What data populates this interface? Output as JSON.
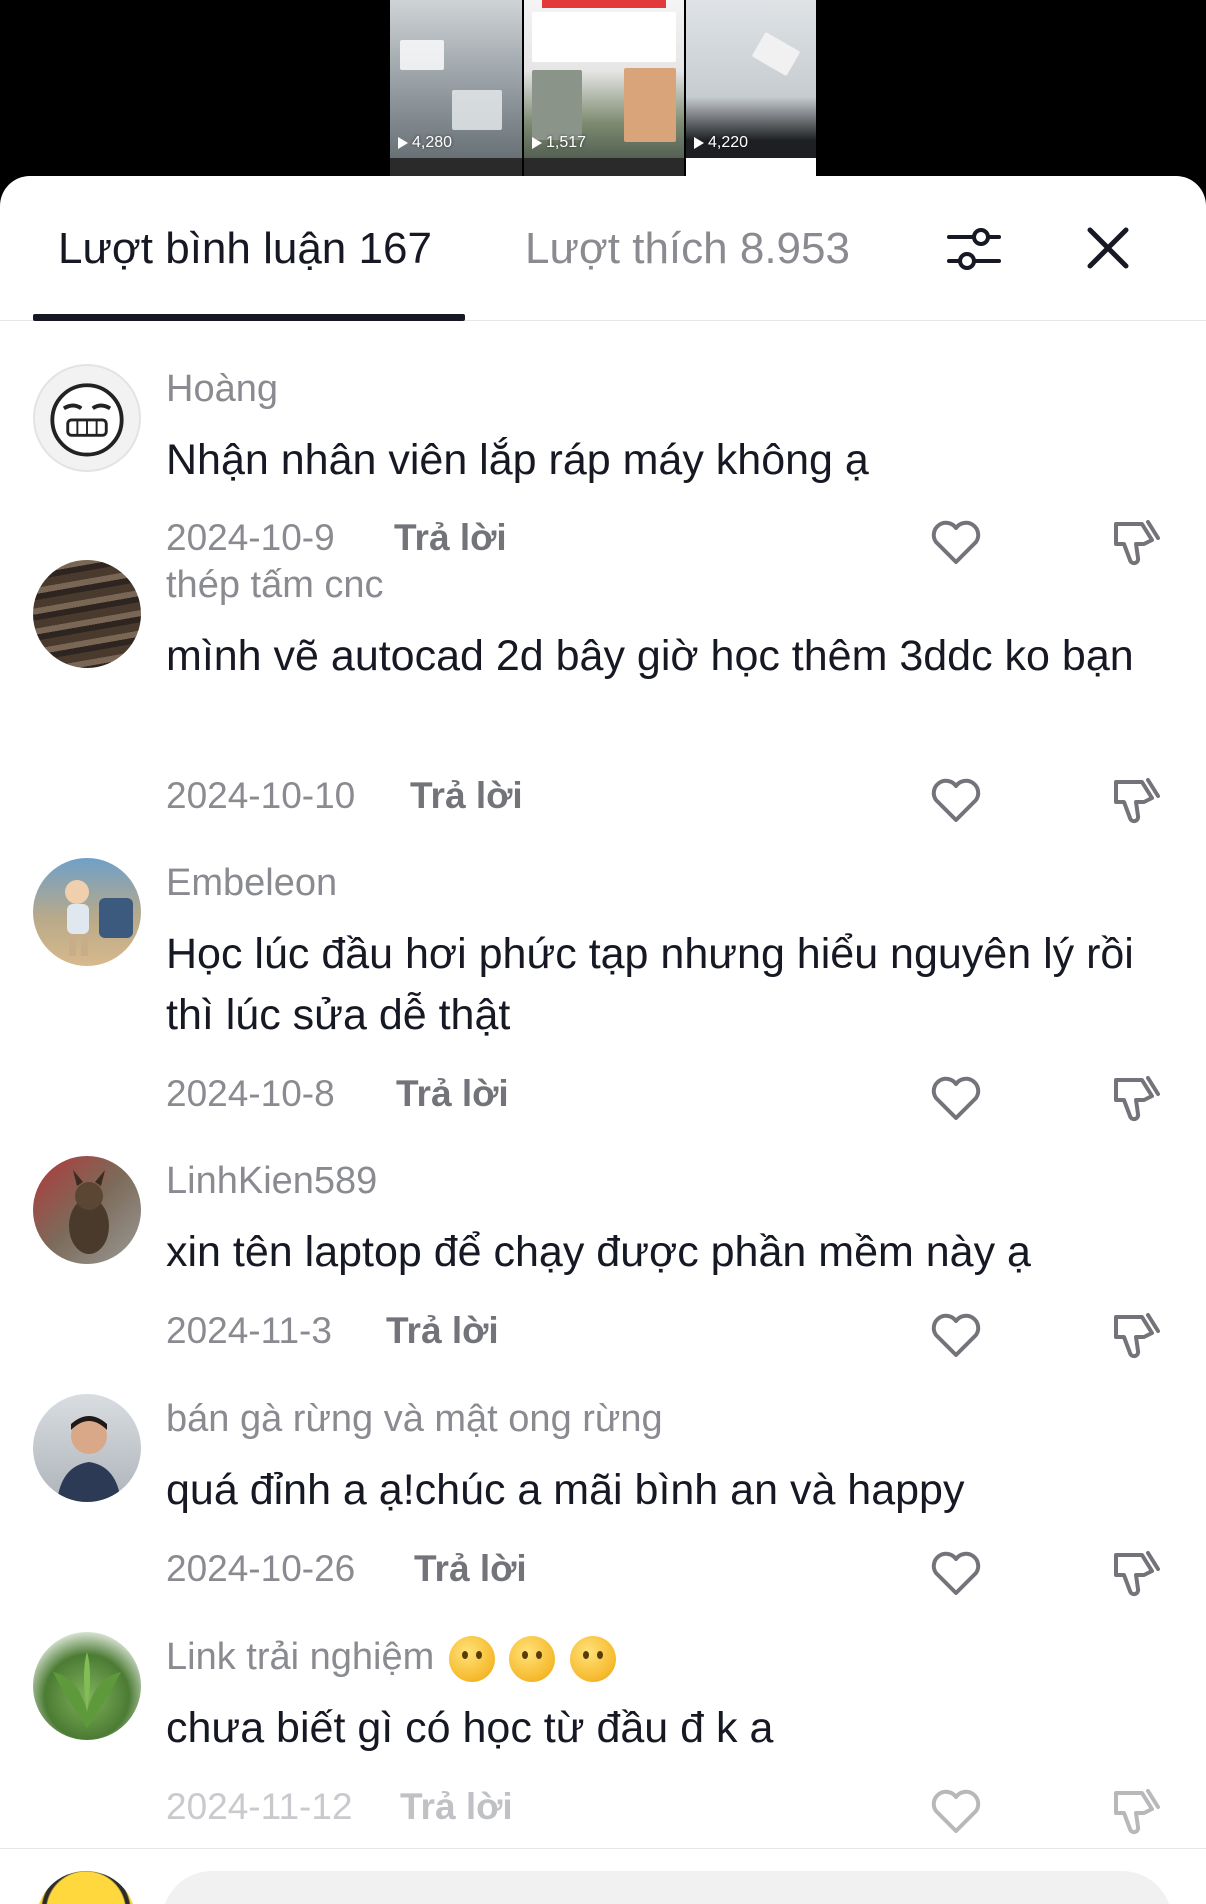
{
  "videos": [
    {
      "views": "4,280"
    },
    {
      "views": "1,517"
    },
    {
      "views": "4,220"
    }
  ],
  "tabs": {
    "comments_label": "Lượt bình luận 167",
    "likes_label": "Lượt thích 8.953"
  },
  "comments": [
    {
      "username": "Hoàng",
      "text": "Nhận nhân viên lắp ráp máy không ạ",
      "date": "2024-10-9",
      "reply_label": "Trả lời"
    },
    {
      "username": "thép tấm cnc",
      "text": "mình vẽ autocad 2d bây giờ học thêm 3ddc ko bạn",
      "date": "2024-10-10",
      "reply_label": "Trả lời"
    },
    {
      "username": "Embeleon",
      "text": "Học lúc đầu hơi phức tạp nhưng hiểu nguyên lý rồi thì lúc sửa dễ thật",
      "date": "2024-10-8",
      "reply_label": "Trả lời"
    },
    {
      "username": "LinhKien589",
      "text": "xin tên laptop để chạy được phần mềm này ạ",
      "date": "2024-11-3",
      "reply_label": "Trả lời"
    },
    {
      "username": "bán gà rừng và mật ong rừng",
      "text": "quá đỉnh a ạ!chúc a mãi bình an và happy",
      "date": "2024-10-26",
      "reply_label": "Trả lời"
    },
    {
      "username": "Link trải nghiệm",
      "text": "chưa biết gì có học từ đầu đ k a",
      "date": "2024-11-12",
      "reply_label": "Trả lời"
    }
  ],
  "colors": {
    "primary_text": "#161823",
    "secondary_text": "#8a8b91",
    "background": "#ffffff"
  }
}
